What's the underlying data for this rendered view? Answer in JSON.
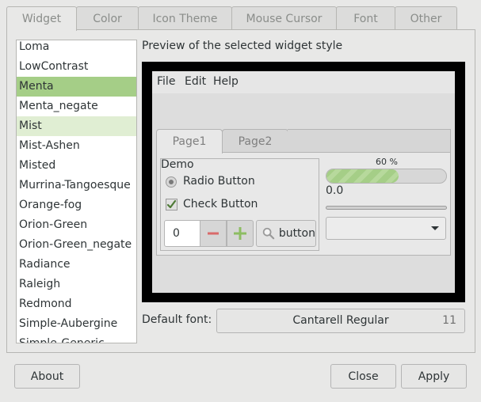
{
  "tabs": [
    {
      "label": "Widget",
      "active": true
    },
    {
      "label": "Color",
      "active": false
    },
    {
      "label": "Icon Theme",
      "active": false
    },
    {
      "label": "Mouse Cursor",
      "active": false
    },
    {
      "label": "Font",
      "active": false
    },
    {
      "label": "Other",
      "active": false
    }
  ],
  "theme_list": {
    "items": [
      {
        "label": "Loma",
        "state": ""
      },
      {
        "label": "LowContrast",
        "state": ""
      },
      {
        "label": "Menta",
        "state": "selected"
      },
      {
        "label": "Menta_negate",
        "state": ""
      },
      {
        "label": "Mist",
        "state": "hover"
      },
      {
        "label": "Mist-Ashen",
        "state": ""
      },
      {
        "label": "Misted",
        "state": ""
      },
      {
        "label": "Murrina-Tangoesque",
        "state": ""
      },
      {
        "label": "Orange-fog",
        "state": ""
      },
      {
        "label": "Orion-Green",
        "state": ""
      },
      {
        "label": "Orion-Green_negate",
        "state": ""
      },
      {
        "label": "Radiance",
        "state": ""
      },
      {
        "label": "Raleigh",
        "state": ""
      },
      {
        "label": "Redmond",
        "state": ""
      },
      {
        "label": "Simple-Aubergine",
        "state": ""
      },
      {
        "label": "Simple-Generic",
        "state": ""
      }
    ]
  },
  "preview": {
    "title": "Preview of the selected widget style",
    "menu": [
      "File",
      "Edit",
      "Help"
    ],
    "notebook_tabs": [
      {
        "label": "Page1",
        "active": true
      },
      {
        "label": "Page2",
        "active": false
      }
    ],
    "demo_frame_label": "Demo",
    "radio_label": "Radio Button",
    "radio_checked": true,
    "check_label": "Check Button",
    "check_checked": true,
    "spin_value": "0",
    "button_label": "button",
    "progress_text": "60 %",
    "progress_fraction": 0.6,
    "scale_value": "0.0",
    "combo_value": ""
  },
  "default_font": {
    "label": "Default font:",
    "name": "Cantarell Regular",
    "size": "11"
  },
  "buttons": {
    "about": "About",
    "close": "Close",
    "apply": "Apply"
  },
  "colors": {
    "accent": "#a5ce87",
    "accent_light": "#e0eed3"
  },
  "icons": {
    "spin_minus": "minus-icon",
    "spin_plus": "plus-icon",
    "button_icon": "search-icon",
    "combo_arrow": "chevron-down-icon",
    "check": "checkmark-icon"
  }
}
